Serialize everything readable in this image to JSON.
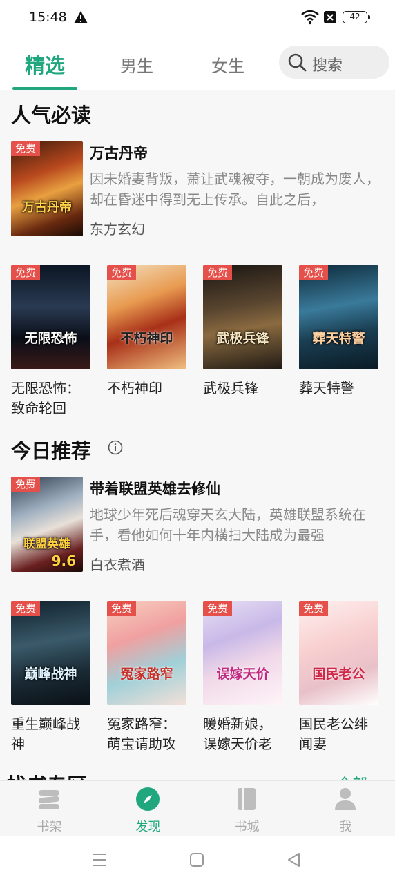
{
  "status": {
    "time": "15:48",
    "battery": "42"
  },
  "tabs": [
    {
      "label": "精选",
      "active": true
    },
    {
      "label": "男生",
      "active": false
    },
    {
      "label": "女生",
      "active": false
    }
  ],
  "search": {
    "placeholder": "搜索"
  },
  "badge_label": "免费",
  "sections": [
    {
      "title": "人气必读",
      "featured": {
        "title": "万古丹帝",
        "cover_text": "万古丹帝",
        "description": "因未婚妻背叛，萧让武魂被夺，一朝成为废人，却在昏迷中得到无上传承。自此之后，",
        "category": "东方玄幻"
      },
      "grid": [
        {
          "title": "无限恐怖：致命轮回",
          "cover_text": "无限恐怖"
        },
        {
          "title": "不朽神印",
          "cover_text": "不朽神印"
        },
        {
          "title": "武极兵锋",
          "cover_text": "武极兵锋"
        },
        {
          "title": "葬天特警",
          "cover_text": "葬天特警"
        }
      ]
    },
    {
      "title": "今日推荐",
      "featured": {
        "title": "带着联盟英雄去修仙",
        "cover_text": "联盟英雄",
        "cover_score": "9.6",
        "description": "地球少年死后魂穿天玄大陆，英雄联盟系统在手，看他如何十年内横扫大陆成为最强",
        "category": "白衣煮酒"
      },
      "grid": [
        {
          "title": "重生巅峰战神",
          "cover_text": "巅峰战神"
        },
        {
          "title": "冤家路窄：萌宝请助攻",
          "cover_text": "冤家路窄"
        },
        {
          "title": "暖婚新娘，误嫁天价老",
          "cover_text": "误嫁天价"
        },
        {
          "title": "国民老公绯闻妻",
          "cover_text": "国民老公"
        }
      ]
    }
  ],
  "next_section": {
    "title": "找书专区",
    "more": "全部"
  },
  "bottom_nav": [
    {
      "label": "书架",
      "icon": "bookshelf-icon",
      "active": false
    },
    {
      "label": "发现",
      "icon": "compass-icon",
      "active": true
    },
    {
      "label": "书城",
      "icon": "book-icon",
      "active": false
    },
    {
      "label": "我",
      "icon": "person-icon",
      "active": false
    }
  ],
  "colors": {
    "accent": "#20a77e",
    "badge": "#e6504a"
  }
}
